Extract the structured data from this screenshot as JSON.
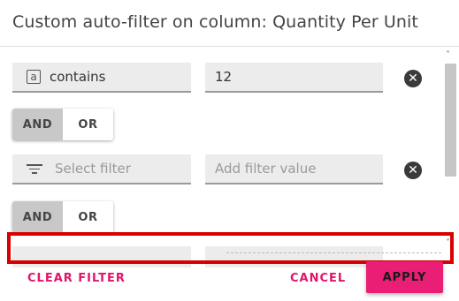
{
  "dialog": {
    "title": "Custom auto-filter on column: Quantity Per Unit"
  },
  "filters": [
    {
      "operator_icon": "text-box-icon",
      "operator_icon_glyph": "a",
      "operator_label": "contains",
      "value": "12",
      "remove_icon": "close-circle-icon",
      "remove_glyph": "✕"
    },
    {
      "operator_icon": "filter-lines-icon",
      "operator_placeholder": "Select filter",
      "value_placeholder": "Add filter value",
      "remove_icon": "close-circle-icon",
      "remove_glyph": "✕"
    }
  ],
  "logic_toggles": [
    {
      "and_label": "AND",
      "or_label": "OR",
      "selected": "AND"
    },
    {
      "and_label": "AND",
      "or_label": "OR",
      "selected": "AND"
    }
  ],
  "scrollbar": {
    "up_glyph": "˄",
    "down_glyph": "˅"
  },
  "footer": {
    "clear_label": "CLEAR FILTER",
    "cancel_label": "CANCEL",
    "apply_label": "APPLY"
  },
  "colors": {
    "accent": "#e91e74",
    "highlight": "#d80000",
    "field_bg": "#ececec",
    "toggle_active": "#c8c8c8"
  }
}
